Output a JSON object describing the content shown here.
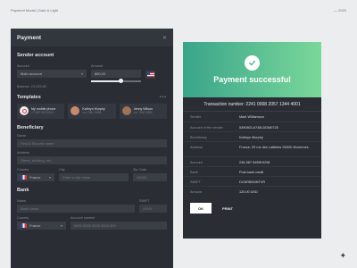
{
  "caption": "Payment Modal | Dark & Light",
  "year": "— 2020",
  "modal": {
    "title": "Payment",
    "sender": {
      "title": "Sender account",
      "account_label": "Account",
      "account_value": "Main account",
      "amount_label": "Amount",
      "amount_value": "880,00",
      "slider_percent": 60,
      "balance": "Balance: 23,325.80"
    },
    "templates": {
      "title": "Templates",
      "items": [
        {
          "name": "My mobile phone",
          "sub": "+7 287 020-0110",
          "color": "#e8e8e8"
        },
        {
          "name": "Kathryn Murphy",
          "sub": "•••• 7941 3281",
          "color": "#c98a6b"
        },
        {
          "name": "Jenny Wilson",
          "sub": "•••• 7941 3281",
          "color": "#a07256"
        }
      ]
    },
    "beneficiary": {
      "title": "Beneficiary",
      "name_label": "Name",
      "name_placeholder": "First & Second name",
      "address_label": "Address",
      "address_placeholder": "Street, building, etc.",
      "country_label": "Country",
      "country_value": "France",
      "city_label": "City",
      "city_placeholder": "Enter a city name",
      "zip_label": "Zip Code",
      "zip_placeholder": "00000"
    },
    "bank": {
      "title": "Bank",
      "name_label": "Name",
      "name_placeholder": "Bank name",
      "swift_label": "SWIFT",
      "swift_placeholder": "XXXX",
      "country_label": "Country",
      "country_value": "France",
      "account_label": "Account number",
      "account_placeholder": "0000 0000 0000 0000 000"
    }
  },
  "receipt": {
    "title": "Payment successful",
    "transaction": "Transaction number: 2241 0008 2057 1344 4001",
    "rows": [
      {
        "key": "Sender",
        "value": "Mark Williamson"
      },
      {
        "key": "Account of the sender",
        "value": "53908GLA748LDDM0725"
      },
      {
        "key": "Beneficiary",
        "value": "Kathryn Murphy"
      },
      {
        "key": "Address",
        "value": "France, 29 rue des Laitières 94300 Vincennes"
      },
      {
        "key": "Account",
        "value": "236-987 5499K9298"
      },
      {
        "key": "Bank",
        "value": "Post bank credit"
      },
      {
        "key": "SWIFT",
        "value": "DCNRBKNNTVR"
      },
      {
        "key": "Amount",
        "value": "120,00 USD"
      }
    ],
    "ok_label": "OK",
    "print_label": "PRINT"
  }
}
